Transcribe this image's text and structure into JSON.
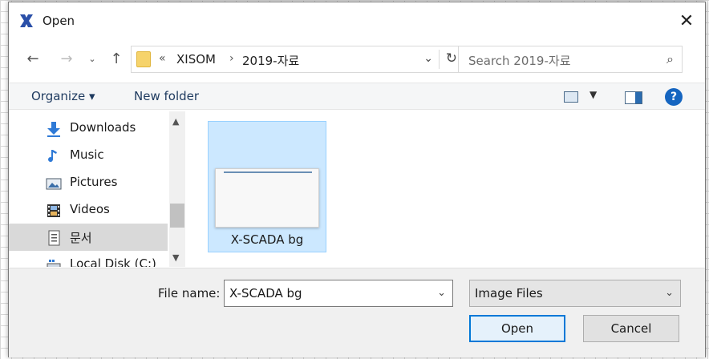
{
  "window": {
    "title": "Open"
  },
  "address": {
    "overflow": "«",
    "crumbs": [
      "XISOM",
      "2019-자료"
    ]
  },
  "search": {
    "placeholder": "Search 2019-자료"
  },
  "toolbar": {
    "organize": "Organize ▾",
    "new_folder": "New folder",
    "help": "?"
  },
  "nav": {
    "items": [
      {
        "label": "Downloads",
        "icon": "download-arrow-icon"
      },
      {
        "label": "Music",
        "icon": "music-note-icon"
      },
      {
        "label": "Pictures",
        "icon": "pictures-icon"
      },
      {
        "label": "Videos",
        "icon": "film-strip-icon"
      },
      {
        "label": "문서",
        "icon": "document-icon",
        "selected": true
      },
      {
        "label": "Local Disk (C:)",
        "icon": "drive-icon"
      }
    ]
  },
  "files": [
    {
      "name": "X-SCADA bg",
      "selected": true
    }
  ],
  "bottom": {
    "file_name_label": "File name:",
    "file_name_value": "X-SCADA bg",
    "file_type": "Image Files",
    "open": "Open",
    "cancel": "Cancel"
  },
  "colors": {
    "accent": "#0078d7",
    "selection": "#cce8ff",
    "help": "#1565c0"
  }
}
